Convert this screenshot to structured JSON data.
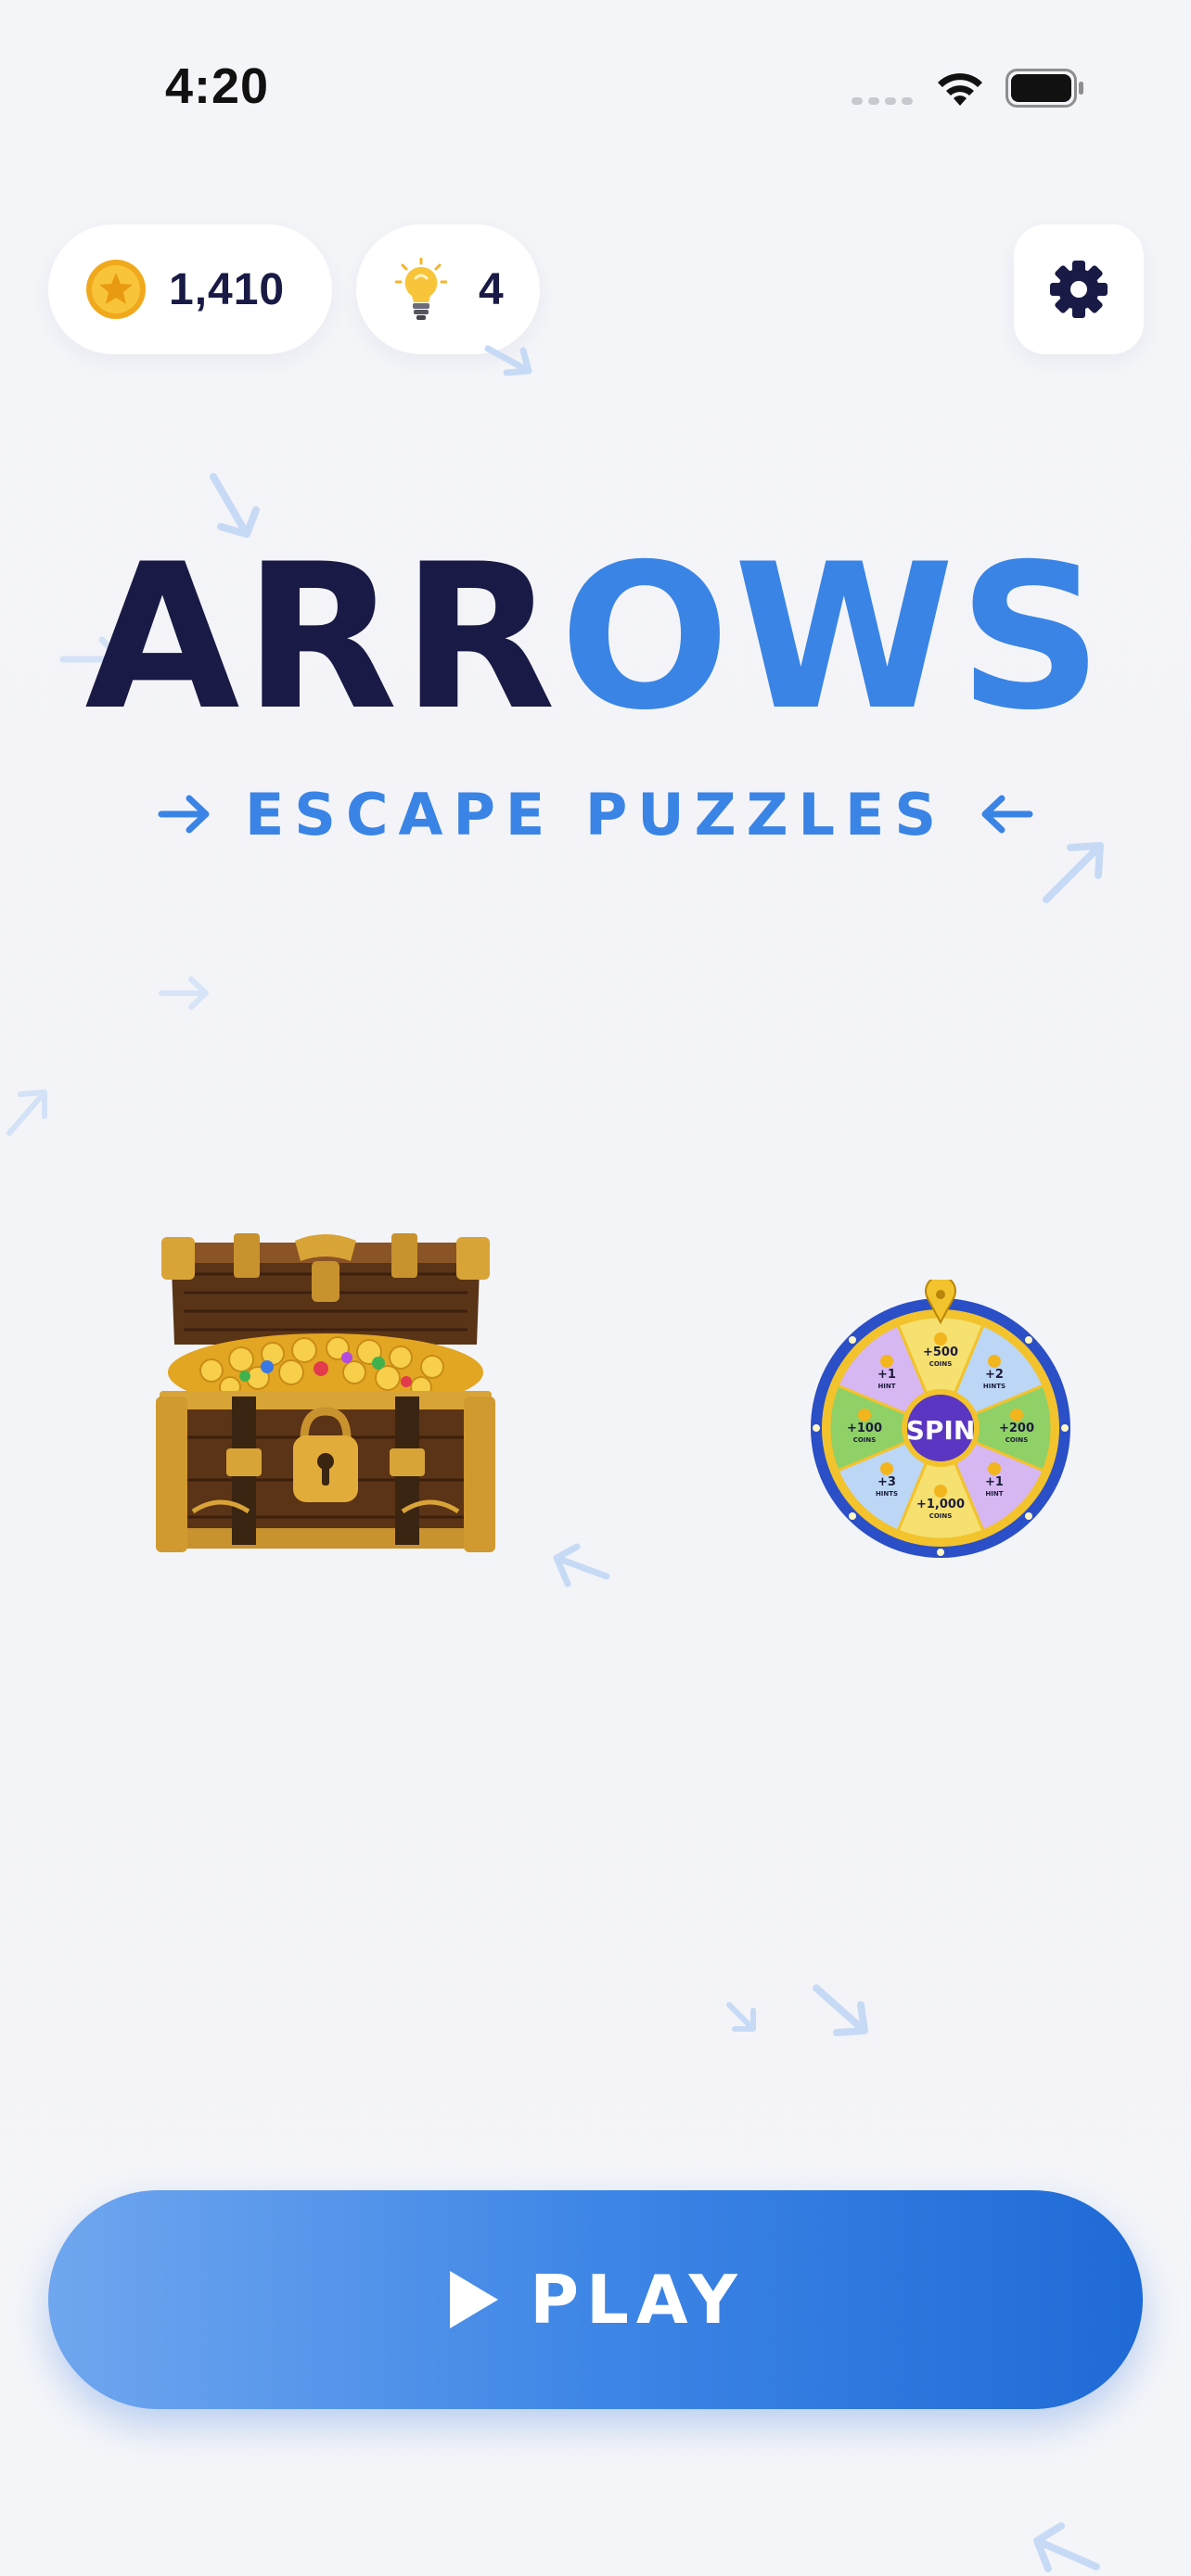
{
  "status_bar": {
    "time": "4:20",
    "icons": [
      "cellular-signal-icon",
      "wifi-icon",
      "battery-icon"
    ]
  },
  "header": {
    "coins": {
      "value": "1,410",
      "icon": "coin-icon"
    },
    "hints": {
      "value": "4",
      "icon": "lightbulb-icon"
    },
    "settings_icon": "gear-icon"
  },
  "title": {
    "part_dark": "ARR",
    "part_blue": "OWS",
    "subtitle": "ESCAPE PUZZLES"
  },
  "wheel": {
    "center_label": "SPIN",
    "segments": [
      {
        "amount": "+500",
        "unit": "COINS"
      },
      {
        "amount": "+2",
        "unit": "HINTS"
      },
      {
        "amount": "+200",
        "unit": "COINS"
      },
      {
        "amount": "+1",
        "unit": "HINT"
      },
      {
        "amount": "+1,000",
        "unit": "COINS"
      },
      {
        "amount": "+3",
        "unit": "HINTS"
      },
      {
        "amount": "+100",
        "unit": "COINS"
      },
      {
        "amount": "+1",
        "unit": "HINT"
      }
    ]
  },
  "play_button": {
    "label": "PLAY",
    "icon": "play-icon"
  },
  "colors": {
    "accent_blue": "#3a84e6",
    "title_dark": "#191a45",
    "background": "#f4f5f9",
    "decor_arrow": "#cfe0f7"
  }
}
